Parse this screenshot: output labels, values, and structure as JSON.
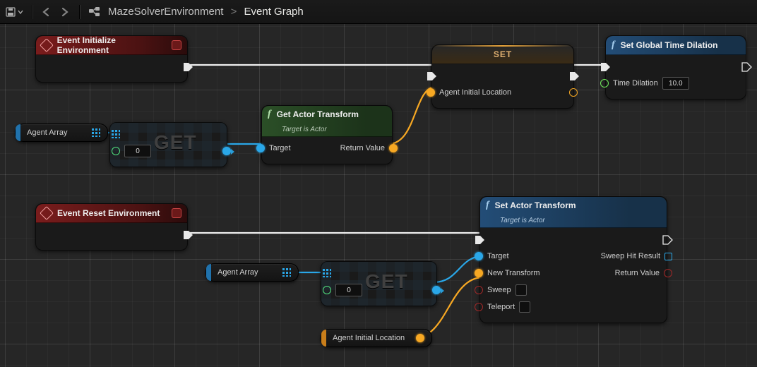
{
  "toolbar": {
    "save_icon": "save-icon",
    "back_icon": "back-icon",
    "forward_icon": "forward-icon",
    "blueprint_icon": "blueprint-icon"
  },
  "breadcrumb": {
    "parent": "MazeSolverEnvironment",
    "sep": ">",
    "current": "Event Graph"
  },
  "nodes": {
    "init_event": {
      "title": "Event Initialize Environment"
    },
    "reset_event": {
      "title": "Event Reset Environment"
    },
    "get_actor_transform": {
      "title": "Get Actor Transform",
      "subtitle": "Target is Actor",
      "pins": {
        "target": "Target",
        "return": "Return Value"
      }
    },
    "set_actor_transform": {
      "title": "Set Actor Transform",
      "subtitle": "Target is Actor",
      "pins": {
        "target": "Target",
        "new_transform": "New Transform",
        "sweep": "Sweep",
        "teleport": "Teleport",
        "sweep_hit": "Sweep Hit Result",
        "return": "Return Value"
      }
    },
    "set_global_time_dilation": {
      "title": "Set Global Time Dilation",
      "pins": {
        "time_dilation": "Time Dilation",
        "value": "10.0"
      }
    },
    "set_var": {
      "title": "SET",
      "pins": {
        "var_name": "Agent Initial Location"
      }
    },
    "get1": {
      "title": "GET",
      "index": "0"
    },
    "get2": {
      "title": "GET",
      "index": "0"
    }
  },
  "vars": {
    "agent_array_1": "Agent Array",
    "agent_array_2": "Agent Array",
    "agent_initial_location": "Agent Initial Location"
  }
}
